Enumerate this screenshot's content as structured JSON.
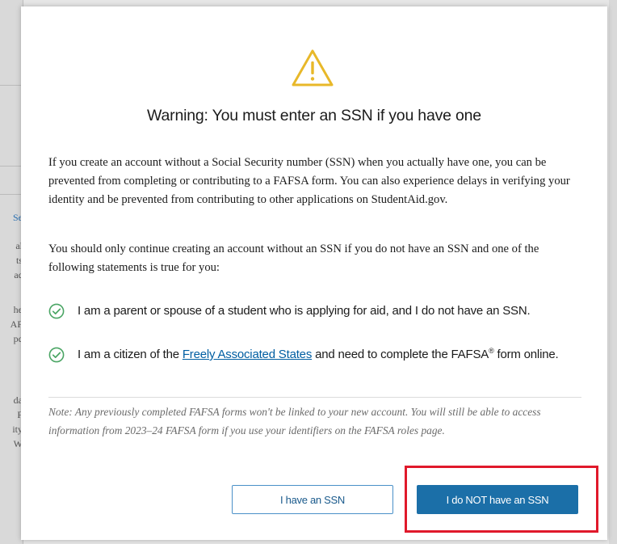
{
  "modal": {
    "title": "Warning: You must enter an SSN if you have one",
    "paragraph1": "If you create an account without a Social Security number (SSN) when you actually have one, you can be prevented from completing or contributing to a FAFSA form. You can also experience delays in verifying your identity and be prevented from contributing to other applications on StudentAid.gov.",
    "paragraph2": "You should only continue creating an account without an SSN if you do not have an SSN and one of the following statements is true for you:",
    "statements": [
      {
        "text": "I am a parent or spouse of a student who is applying for aid, and I do not have an SSN."
      },
      {
        "prefix": "I am a citizen of the ",
        "link": "Freely Associated States",
        "middle": " and need to complete the FAFSA",
        "sup": "®",
        "suffix": " form online."
      }
    ],
    "note": "Note: Any previously completed FAFSA forms won't be linked to your new account. You will still be able to access information from 2023–24 FAFSA form if you use your identifiers on the FAFSA roles page.",
    "buttons": {
      "have_ssn": "I have an SSN",
      "no_ssn": "I do NOT have an SSN"
    }
  },
  "background_fragments": [
    "Se",
    "al",
    "ts",
    "ac",
    "he",
    "AF",
    "pc",
    "da",
    "F",
    "ity",
    "W"
  ],
  "colors": {
    "warning": "#e8b829",
    "check": "#4aa564",
    "link": "#005ea2",
    "primary": "#1b6fa8",
    "highlight": "#e0192b"
  },
  "icons": {
    "warning": "warning-triangle-icon",
    "check": "check-circle-icon"
  }
}
